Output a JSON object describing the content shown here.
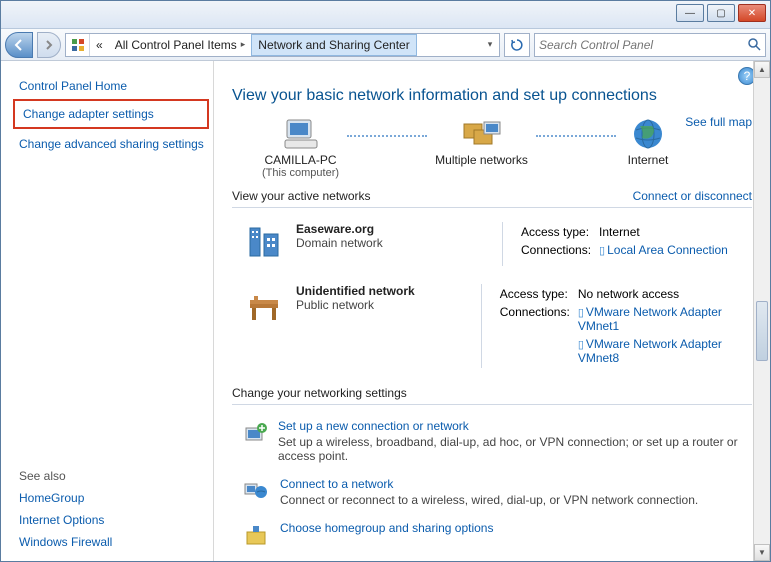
{
  "titlebar": {
    "min": "—",
    "max": "▢",
    "close": "✕"
  },
  "nav": {
    "bc_prefix": "«",
    "bc1": "All Control Panel Items",
    "bc2": "Network and Sharing Center",
    "search_placeholder": "Search Control Panel"
  },
  "sidebar": {
    "home": "Control Panel Home",
    "adapter": "Change adapter settings",
    "advanced": "Change advanced sharing settings",
    "seealso": "See also",
    "homegroup": "HomeGroup",
    "inetopt": "Internet Options",
    "firewall": "Windows Firewall"
  },
  "main": {
    "heading": "View your basic network information and set up connections",
    "map_link": "See full map",
    "ni": {
      "comp": "CAMILLA-PC",
      "comp_sub": "(This computer)",
      "multi": "Multiple networks",
      "internet": "Internet"
    },
    "active_head": "View your active networks",
    "connect_link": "Connect or disconnect",
    "net1": {
      "name": "Easeware.org",
      "type": "Domain network",
      "access_lbl": "Access type:",
      "access_val": "Internet",
      "conn_lbl": "Connections:",
      "conn1": "Local Area Connection"
    },
    "net2": {
      "name": "Unidentified network",
      "type": "Public network",
      "access_lbl": "Access type:",
      "access_val": "No network access",
      "conn_lbl": "Connections:",
      "conn1": "VMware Network Adapter VMnet1",
      "conn2": "VMware Network Adapter VMnet8"
    },
    "settings_head": "Change your networking settings",
    "task1": {
      "title": "Set up a new connection or network",
      "desc": "Set up a wireless, broadband, dial-up, ad hoc, or VPN connection; or set up a router or access point."
    },
    "task2": {
      "title": "Connect to a network",
      "desc": "Connect or reconnect to a wireless, wired, dial-up, or VPN network connection."
    },
    "task3": {
      "title": "Choose homegroup and sharing options"
    }
  }
}
